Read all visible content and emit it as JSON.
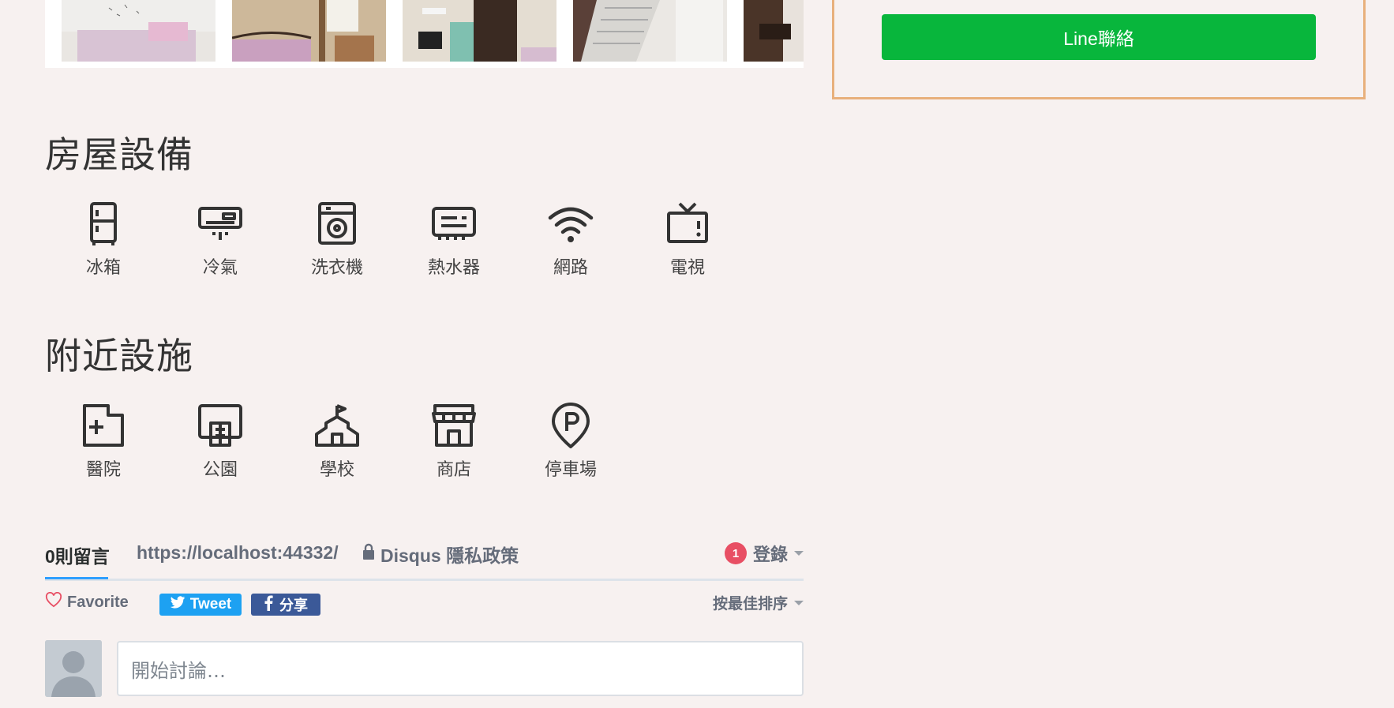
{
  "contact": {
    "line_button": "Line聯絡"
  },
  "photos": [
    {
      "alt": "bedroom-photo-1"
    },
    {
      "alt": "bedroom-photo-2"
    },
    {
      "alt": "room-photo-3"
    },
    {
      "alt": "fridge-photo-4"
    },
    {
      "alt": "room-photo-5"
    }
  ],
  "equipment": {
    "title": "房屋設備",
    "items": [
      {
        "label": "冰箱",
        "icon": "fridge-icon"
      },
      {
        "label": "冷氣",
        "icon": "air-conditioner-icon"
      },
      {
        "label": "洗衣機",
        "icon": "washing-machine-icon"
      },
      {
        "label": "熱水器",
        "icon": "water-heater-icon"
      },
      {
        "label": "網路",
        "icon": "wifi-icon"
      },
      {
        "label": "電視",
        "icon": "tv-icon"
      }
    ]
  },
  "nearby": {
    "title": "附近設施",
    "items": [
      {
        "label": "醫院",
        "icon": "hospital-icon"
      },
      {
        "label": "公園",
        "icon": "park-icon"
      },
      {
        "label": "學校",
        "icon": "school-icon"
      },
      {
        "label": "商店",
        "icon": "store-icon"
      },
      {
        "label": "停車場",
        "icon": "parking-icon"
      }
    ]
  },
  "disqus": {
    "count_label": "0則留言",
    "site_url": "https://localhost:44332/",
    "privacy_label": "Disqus 隱私政策",
    "notification_count": "1",
    "login_label": "登錄",
    "favorite_label": "Favorite",
    "tweet_label": "Tweet",
    "share_label": "分享",
    "sort_label": "按最佳排序",
    "comment_placeholder": "開始討論…"
  },
  "colors": {
    "background": "#f7f1f0",
    "line_green": "#08b63c",
    "box_border": "#e8b07c",
    "tweet_blue": "#1da1f2",
    "facebook_blue": "#3b5998",
    "notif_red": "#e84f64"
  }
}
